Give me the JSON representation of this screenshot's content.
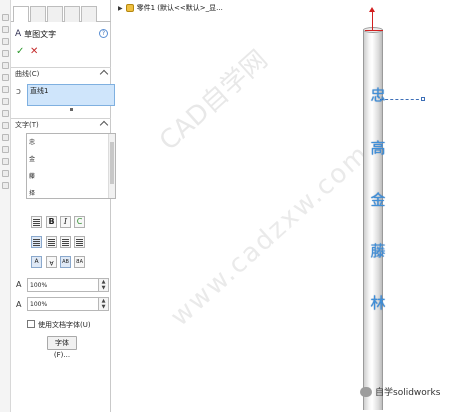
{
  "tree": {
    "label": "零件1 (默认<<默认>_显..."
  },
  "panel": {
    "title": "草图文字",
    "curve_section": {
      "label": "曲线(C)",
      "item": "直线1"
    },
    "text_section": {
      "label": "文字(T)",
      "lines": [
        "忠",
        "金",
        "藤",
        "择"
      ]
    },
    "format_buttons": {
      "bold": "B",
      "italic": "I",
      "rotate": "C"
    },
    "align_buttons": {
      "a1": "A",
      "a2": "AB"
    },
    "width_factor": "100%",
    "spacing": "100%",
    "checkbox_label": "使用文档字体(U)",
    "font_button": "字体(F)..."
  },
  "graphics": {
    "glyphs": [
      "忠",
      "高",
      "金",
      "藤",
      "林"
    ]
  },
  "watermark": {
    "line1": "CAD自学网",
    "line2": "www.cadzxw.com"
  },
  "brand": "自学solidworks"
}
